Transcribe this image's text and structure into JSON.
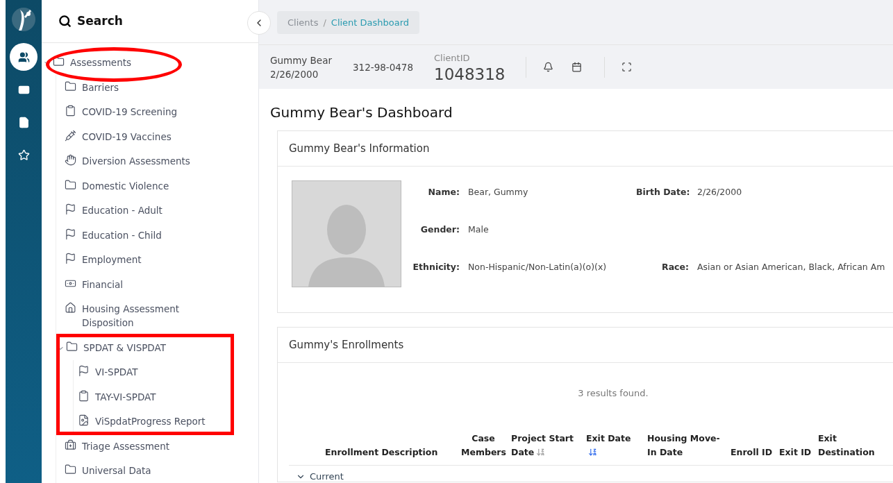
{
  "rail": {
    "items": [
      {
        "kind": "users",
        "selected": true
      },
      {
        "kind": "card",
        "selected": false
      },
      {
        "kind": "file",
        "selected": false
      },
      {
        "kind": "star",
        "selected": false
      }
    ]
  },
  "sidebar": {
    "title": "Search",
    "tree": [
      {
        "label": "Assessments",
        "kind": "folder",
        "expanded": true,
        "circled": true,
        "children": [
          {
            "label": "Barriers",
            "kind": "folder"
          },
          {
            "label": "COVID-19 Screening",
            "kind": "clipboard"
          },
          {
            "label": "COVID-19 Vaccines",
            "kind": "syringe"
          },
          {
            "label": "Diversion Assessments",
            "kind": "hand"
          },
          {
            "label": "Domestic Violence",
            "kind": "folder"
          },
          {
            "label": "Education - Adult",
            "kind": "flag"
          },
          {
            "label": "Education - Child",
            "kind": "flag"
          },
          {
            "label": "Employment",
            "kind": "flag"
          },
          {
            "label": "Financial",
            "kind": "money"
          },
          {
            "label": "Housing Assessment Disposition",
            "kind": "home"
          },
          {
            "label": "SPDAT & VISPDAT",
            "kind": "folder",
            "expanded": true,
            "boxed": true,
            "children": [
              {
                "label": "VI-SPDAT",
                "kind": "flag"
              },
              {
                "label": "TAY-VI-SPDAT",
                "kind": "clipboard"
              },
              {
                "label": "ViSpdatProgress Report",
                "kind": "file"
              }
            ]
          },
          {
            "label": "Triage Assessment",
            "kind": "medkit"
          },
          {
            "label": "Universal Data",
            "kind": "folder"
          }
        ]
      }
    ]
  },
  "breadcrumb": {
    "separator": "/",
    "items": [
      {
        "label": "Clients",
        "selected": false
      },
      {
        "label": "Client Dashboard",
        "selected": true
      }
    ]
  },
  "client": {
    "name": "Gummy Bear",
    "birth": "2/26/2000",
    "ssn": "312-98-0478",
    "id_label": "ClientID",
    "id": "1048318"
  },
  "page_title": "Gummy Bear's Dashboard",
  "info": {
    "title": "Gummy Bear's Information",
    "rows": [
      [
        {
          "label": "Name:",
          "value": "Bear, Gummy"
        },
        {
          "label": "Birth Date:",
          "value": "2/26/2000"
        }
      ],
      [
        {
          "label": "Gender:",
          "value": "Male"
        }
      ],
      [
        {
          "label": "Ethnicity:",
          "value": "Non-Hispanic/Non-Latin(a)(o)(x)"
        },
        {
          "label": "Race:",
          "value": "Asian or Asian American, Black, African Am"
        }
      ]
    ]
  },
  "enrollments": {
    "title": "Gummy's Enrollments",
    "results": "3 results found.",
    "columns": [
      {
        "label": "Enrollment Description"
      },
      {
        "label": "Case Members"
      },
      {
        "label": "Project Start Date",
        "sorted": false
      },
      {
        "label": "Exit Date",
        "sorted": true
      },
      {
        "label": "Housing Move-In Date"
      },
      {
        "label": "Enroll ID"
      },
      {
        "label": "Exit ID"
      },
      {
        "label": "Exit Destination"
      }
    ],
    "group": {
      "label": "Current",
      "expanded": true
    }
  }
}
